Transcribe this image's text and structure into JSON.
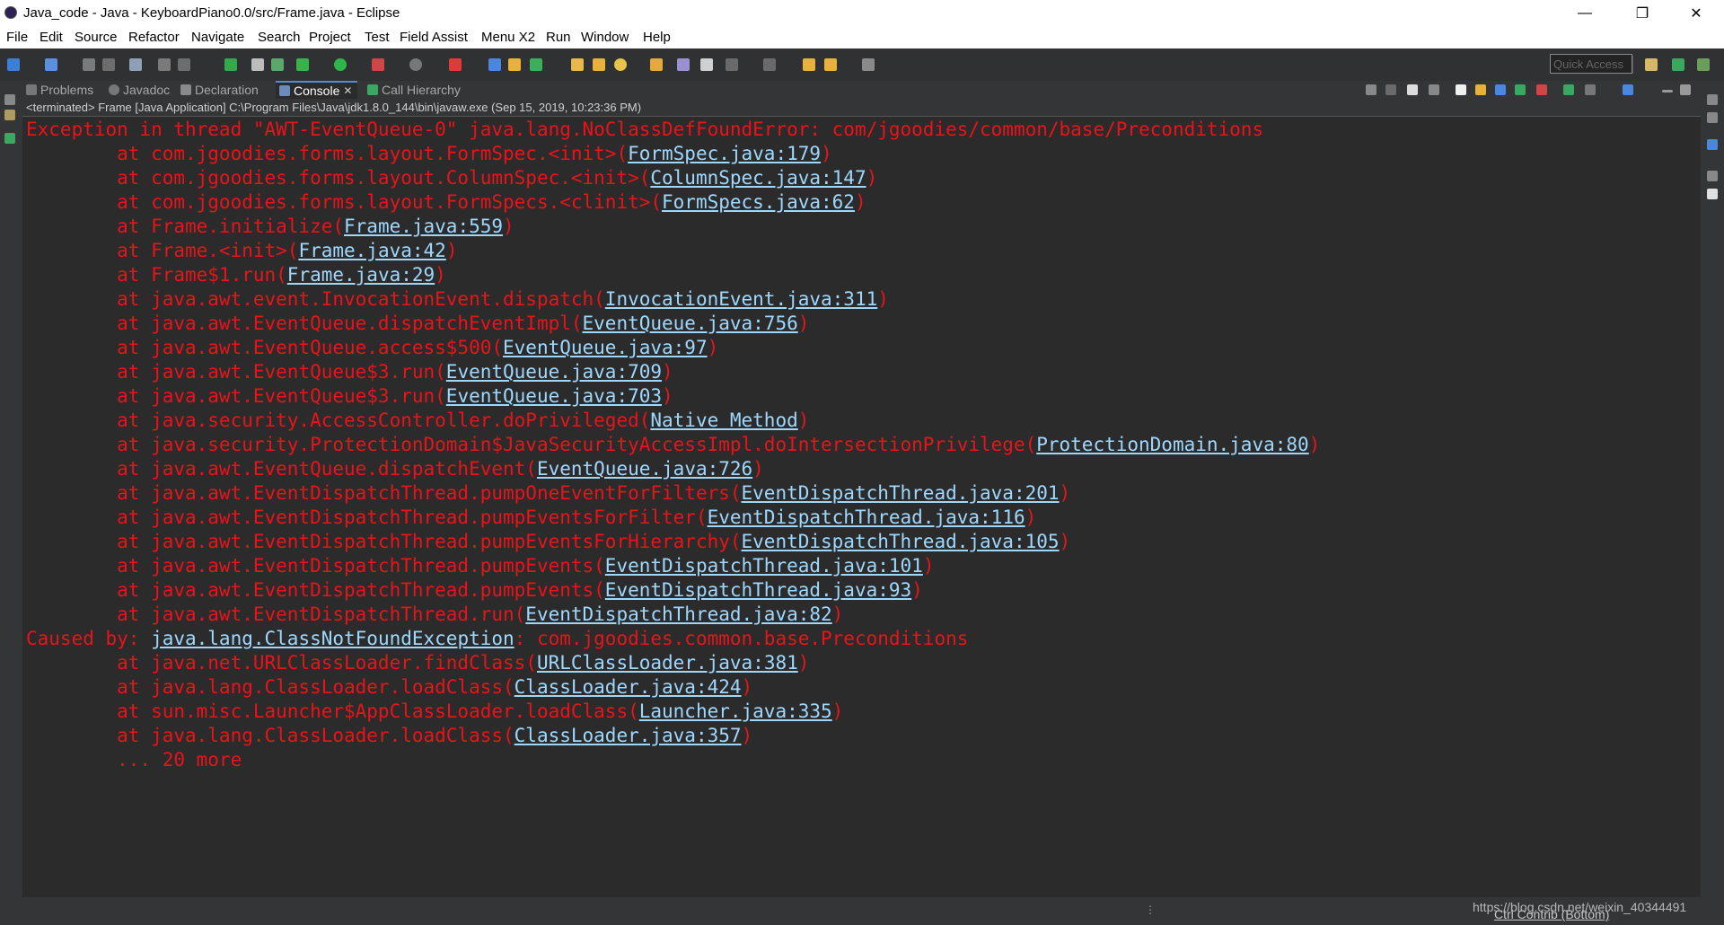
{
  "window": {
    "title": "Java_code - Java - KeyboardPiano0.0/src/Frame.java - Eclipse",
    "min": "—",
    "max": "❐",
    "close": "✕"
  },
  "menu": [
    "File",
    "Edit",
    "Source",
    "Refactor",
    "Navigate",
    "Search",
    "Project",
    "Test",
    "Field Assist",
    "Menu X2",
    "Run",
    "Window",
    "Help"
  ],
  "quick_access": "Quick Access",
  "tabs": {
    "problems": "Problems",
    "javadoc": "Javadoc",
    "declaration": "Declaration",
    "console": "Console",
    "call_hierarchy": "Call Hierarchy"
  },
  "console": {
    "status": "<terminated> Frame [Java Application] C:\\Program Files\\Java\\jdk1.8.0_144\\bin\\javaw.exe (Sep 15, 2019, 10:23:36 PM)",
    "lines": [
      {
        "pre": "Exception in thread \"AWT-EventQueue-0\" java.lang.NoClassDefFoundError: com/jgoodies/common/base/Preconditions",
        "link": "",
        "post": ""
      },
      {
        "pre": "        at com.jgoodies.forms.layout.FormSpec.<init>(",
        "link": "FormSpec.java:179",
        "post": ")"
      },
      {
        "pre": "        at com.jgoodies.forms.layout.ColumnSpec.<init>(",
        "link": "ColumnSpec.java:147",
        "post": ")"
      },
      {
        "pre": "        at com.jgoodies.forms.layout.FormSpecs.<clinit>(",
        "link": "FormSpecs.java:62",
        "post": ")"
      },
      {
        "pre": "        at Frame.initialize(",
        "link": "Frame.java:559",
        "post": ")"
      },
      {
        "pre": "        at Frame.<init>(",
        "link": "Frame.java:42",
        "post": ")"
      },
      {
        "pre": "        at Frame$1.run(",
        "link": "Frame.java:29",
        "post": ")"
      },
      {
        "pre": "        at java.awt.event.InvocationEvent.dispatch(",
        "link": "InvocationEvent.java:311",
        "post": ")"
      },
      {
        "pre": "        at java.awt.EventQueue.dispatchEventImpl(",
        "link": "EventQueue.java:756",
        "post": ")"
      },
      {
        "pre": "        at java.awt.EventQueue.access$500(",
        "link": "EventQueue.java:97",
        "post": ")"
      },
      {
        "pre": "        at java.awt.EventQueue$3.run(",
        "link": "EventQueue.java:709",
        "post": ")"
      },
      {
        "pre": "        at java.awt.EventQueue$3.run(",
        "link": "EventQueue.java:703",
        "post": ")"
      },
      {
        "pre": "        at java.security.AccessController.doPrivileged(",
        "link": "Native Method",
        "post": ")"
      },
      {
        "pre": "        at java.security.ProtectionDomain$JavaSecurityAccessImpl.doIntersectionPrivilege(",
        "link": "ProtectionDomain.java:80",
        "post": ")"
      },
      {
        "pre": "        at java.awt.EventQueue.dispatchEvent(",
        "link": "EventQueue.java:726",
        "post": ")"
      },
      {
        "pre": "        at java.awt.EventDispatchThread.pumpOneEventForFilters(",
        "link": "EventDispatchThread.java:201",
        "post": ")"
      },
      {
        "pre": "        at java.awt.EventDispatchThread.pumpEventsForFilter(",
        "link": "EventDispatchThread.java:116",
        "post": ")"
      },
      {
        "pre": "        at java.awt.EventDispatchThread.pumpEventsForHierarchy(",
        "link": "EventDispatchThread.java:105",
        "post": ")"
      },
      {
        "pre": "        at java.awt.EventDispatchThread.pumpEvents(",
        "link": "EventDispatchThread.java:101",
        "post": ")"
      },
      {
        "pre": "        at java.awt.EventDispatchThread.pumpEvents(",
        "link": "EventDispatchThread.java:93",
        "post": ")"
      },
      {
        "pre": "        at java.awt.EventDispatchThread.run(",
        "link": "EventDispatchThread.java:82",
        "post": ")"
      },
      {
        "pre": "Caused by: ",
        "link": "java.lang.ClassNotFoundException",
        "post": ": com.jgoodies.common.base.Preconditions"
      },
      {
        "pre": "        at java.net.URLClassLoader.findClass(",
        "link": "URLClassLoader.java:381",
        "post": ")"
      },
      {
        "pre": "        at java.lang.ClassLoader.loadClass(",
        "link": "ClassLoader.java:424",
        "post": ")"
      },
      {
        "pre": "        at sun.misc.Launcher$AppClassLoader.loadClass(",
        "link": "Launcher.java:335",
        "post": ")"
      },
      {
        "pre": "        at java.lang.ClassLoader.loadClass(",
        "link": "ClassLoader.java:357",
        "post": ")"
      },
      {
        "pre": "        ... 20 more",
        "link": "",
        "post": ""
      }
    ]
  },
  "status_bar": {
    "trim": "Ctrl Contrib (Bottom)",
    "watermark": "https://blog.csdn.net/weixin_40344491"
  }
}
